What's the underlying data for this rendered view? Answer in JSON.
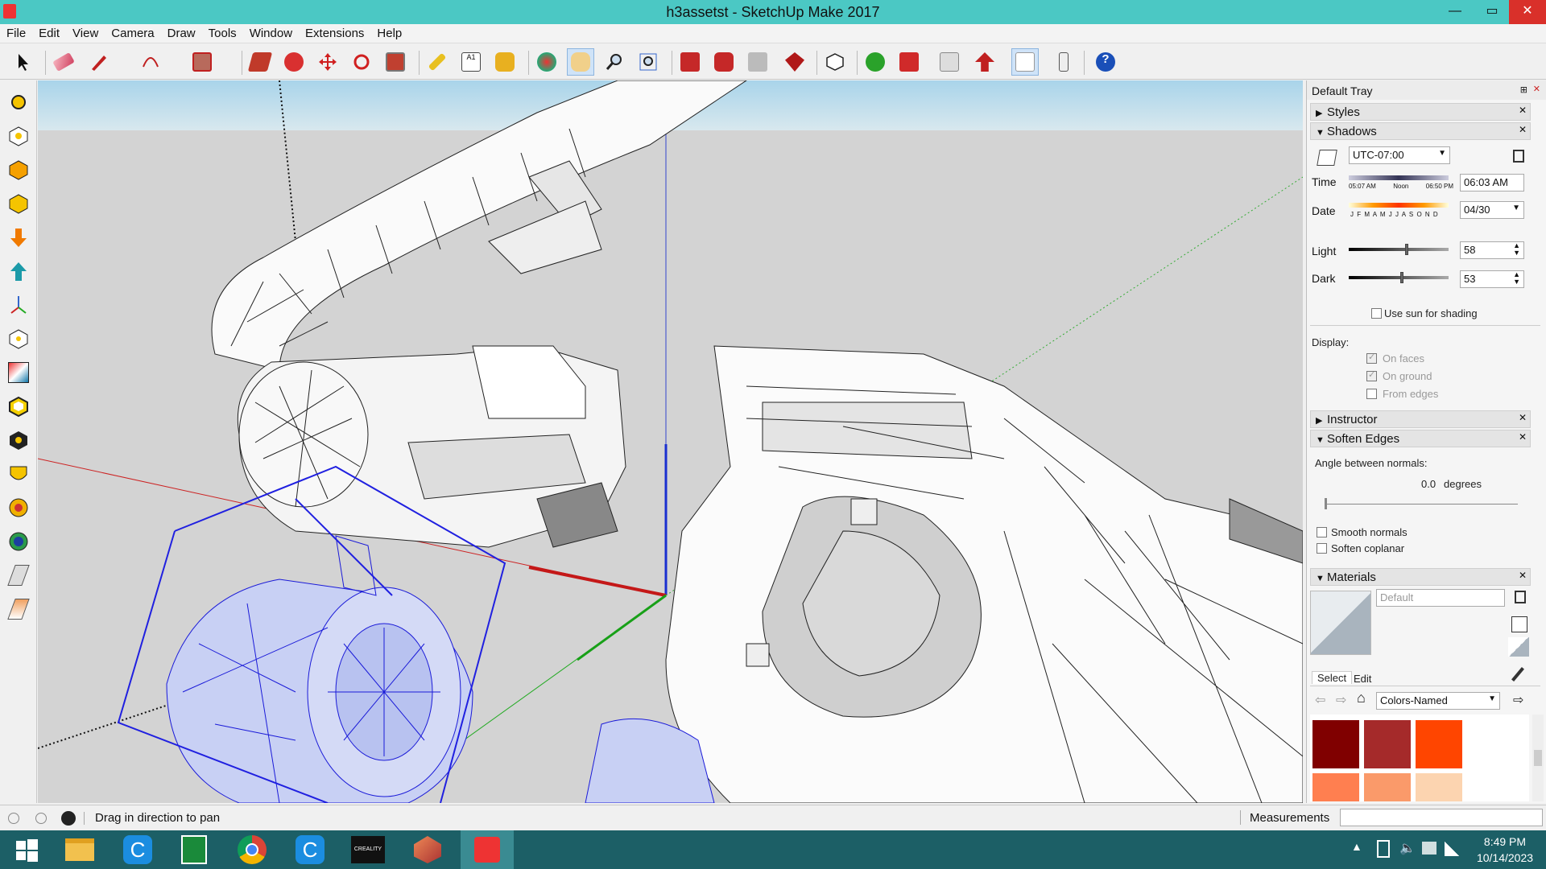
{
  "window": {
    "title": "h3assetst - SketchUp Make 2017",
    "minimize_glyph": "—",
    "maximize_glyph": "▭",
    "close_glyph": "✕"
  },
  "menu": [
    "File",
    "Edit",
    "View",
    "Camera",
    "Draw",
    "Tools",
    "Window",
    "Extensions",
    "Help"
  ],
  "toolbar_icons": [
    "select-icon",
    "eraser-icon",
    "pencil-icon",
    "arc-icon",
    "rectangle-icon",
    "push-pull-icon",
    "follow-me-icon",
    "move-icon",
    "rotate-icon",
    "scale-icon",
    "tape-measure-icon",
    "text-icon",
    "paint-bucket-icon",
    "orbit-icon",
    "pan-icon",
    "zoom-icon",
    "zoom-extents-icon",
    "3d-warehouse-icon",
    "extension-warehouse-icon",
    "layout-icon",
    "extension-manager-icon",
    "components-icon",
    "add-location-icon",
    "toggle-terrain-icon",
    "photo-texture-icon",
    "share-model-icon",
    "xray-icon",
    "section-icon",
    "help-icon"
  ],
  "left_tools": [
    "sun-icon",
    "shadow-icon",
    "light-icon",
    "hex-icon",
    "arrow-down-icon",
    "arrow-up-icon",
    "axes-icon",
    "circle-icon",
    "gradient-icon",
    "hex-outline-icon",
    "hex-dark-icon",
    "shield-icon",
    "ball-icon",
    "globe-icon",
    "eraser-soft-icon",
    "eraser-hard-icon"
  ],
  "tray": {
    "title": "Default Tray",
    "pin_glyph": "⊞",
    "close_glyph": "✕",
    "sections": {
      "styles": "Styles",
      "shadows": "Shadows",
      "instructor": "Instructor",
      "soften_edges": "Soften Edges",
      "materials": "Materials"
    },
    "shadows": {
      "timezone": "UTC-07:00",
      "time_label": "Time",
      "time_value": "06:03 AM",
      "time_scale": [
        "05:07 AM",
        "Noon",
        "06:50 PM"
      ],
      "date_label": "Date",
      "date_value": "04/30",
      "months": "J F M A M J J A S O N D",
      "light_label": "Light",
      "light_value": "58",
      "light_level": 0.58,
      "dark_label": "Dark",
      "dark_value": "53",
      "dark_level": 0.53,
      "use_sun": "Use sun for shading",
      "display_label": "Display:",
      "on_faces": "On faces",
      "on_ground": "On ground",
      "from_edges": "From edges"
    },
    "soften": {
      "angle_label": "Angle between normals:",
      "angle_value": "0.0",
      "angle_unit": "degrees",
      "smooth_normals": "Smooth normals",
      "soften_coplanar": "Soften coplanar"
    },
    "materials": {
      "name": "Default",
      "tab_select": "Select",
      "tab_edit": "Edit",
      "library": "Colors-Named",
      "swatches": [
        "#800000",
        "#a52a2a",
        "#ff4500",
        "#ff7f50",
        "#fa9a6a",
        "#fcd4b0"
      ]
    }
  },
  "status": {
    "hint": "Drag in direction to pan",
    "measurements_label": "Measurements",
    "measurements_value": ""
  },
  "taskbar": {
    "apps": [
      "start-icon",
      "file-explorer-icon",
      "cura-icon",
      "calculator-icon",
      "chrome-icon",
      "cura-alt-icon",
      "creality-icon",
      "3d-print-icon",
      "sketchup-icon"
    ],
    "creality_label": "CREALITY",
    "time": "8:49 PM",
    "date": "10/14/2023"
  }
}
